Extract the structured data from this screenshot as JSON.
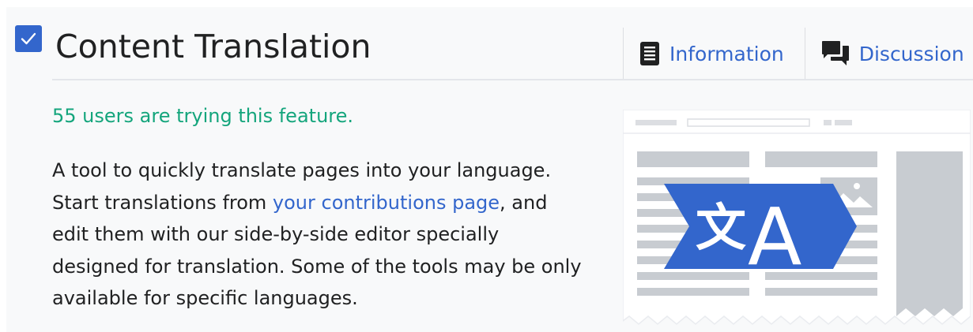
{
  "feature": {
    "title": "Content Translation",
    "checked": true,
    "stat": "55 users are trying this feature.",
    "description": {
      "before_link": "A tool to quickly translate pages into your language. Start translations from ",
      "link": "your contributions page",
      "after_link": ", and edit them with our side-by-side editor specially designed for translation. Some of the tools may be only available for specific languages."
    }
  },
  "tabs": [
    {
      "label": "Information",
      "icon": "document-icon"
    },
    {
      "label": "Discussion",
      "icon": "speech-bubbles-icon"
    }
  ],
  "illustration": {
    "glyph_cjk": "文",
    "glyph_latin": "A"
  },
  "colors": {
    "accent": "#3366cc",
    "stat": "#14a57c",
    "text": "#202122",
    "panel_bg": "#f8f9fa"
  }
}
